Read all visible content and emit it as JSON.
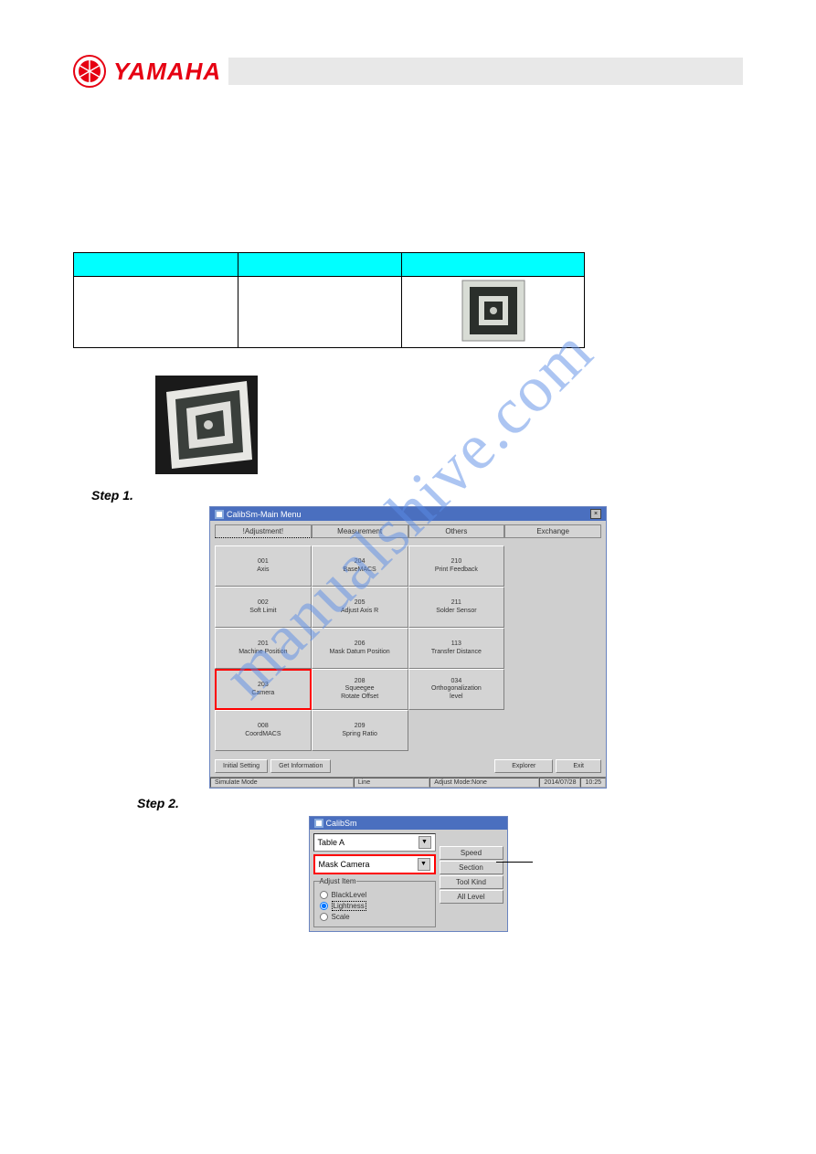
{
  "header": {
    "brand": "YAMAHA"
  },
  "tool_table": {
    "headers": [
      "",
      "",
      ""
    ],
    "cells": [
      "",
      "",
      ""
    ]
  },
  "steps": {
    "step1": "Step 1.",
    "step2": "Step 2."
  },
  "screenshot1": {
    "title": "CalibSm-Main Menu",
    "tabs": [
      "!Adjustment!",
      "Measurement",
      "Others",
      "Exchange"
    ],
    "buttons": [
      {
        "num": "001",
        "label": "Axis"
      },
      {
        "num": "204",
        "label": "BaseMACS"
      },
      {
        "num": "210",
        "label": "Print Feedback"
      },
      {
        "blank": true
      },
      {
        "num": "002",
        "label": "Soft Limit"
      },
      {
        "num": "205",
        "label": "Adjust Axis R"
      },
      {
        "num": "211",
        "label": "Solder Sensor"
      },
      {
        "blank": true
      },
      {
        "num": "201",
        "label": "Machine Position"
      },
      {
        "num": "206",
        "label": "Mask Datum Position"
      },
      {
        "num": "113",
        "label": "Transfer Distance"
      },
      {
        "blank": true
      },
      {
        "num": "203",
        "label": "Camera",
        "camera": true
      },
      {
        "num": "208",
        "label": "Squeegee\nRotate Offset"
      },
      {
        "num": "034",
        "label": "Orthogonalization\nlevel"
      },
      {
        "blank": true
      },
      {
        "num": "008",
        "label": "CoordMACS"
      },
      {
        "num": "209",
        "label": "Spring Ratio"
      },
      {
        "blank": true
      },
      {
        "blank": true
      }
    ],
    "bottom": {
      "initial": "Initial Setting",
      "getinfo": "Get Information",
      "explorer": "Explorer",
      "exit": "Exit"
    },
    "status": {
      "mode": "Simulate Mode",
      "line": "Line",
      "adjust": "Adjust Mode:None",
      "date": "2014/07/28",
      "time": "10:25"
    }
  },
  "screenshot2": {
    "title": "CalibSm",
    "combo1": "Table A",
    "combo2": "Mask Camera",
    "fieldset_legend": "Adjust Item",
    "radios": [
      "BlackLevel",
      "Lightness",
      "Scale"
    ],
    "rbuttons": [
      "Speed",
      "Section",
      "Tool Kind",
      "All Level"
    ]
  },
  "watermark": "manualshive.com"
}
